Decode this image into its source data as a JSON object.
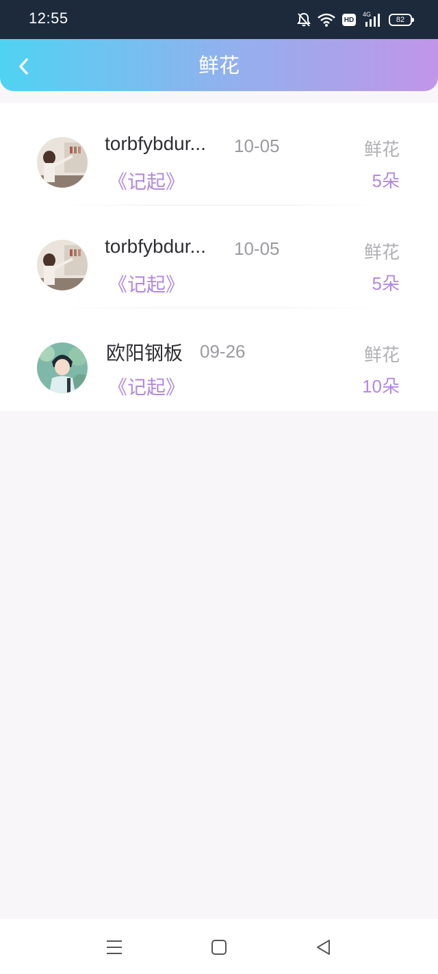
{
  "status_bar": {
    "time": "12:55",
    "network": "4G",
    "hd": "HD",
    "battery": "82"
  },
  "header": {
    "title": "鲜花",
    "back_icon": "chevron-left-icon"
  },
  "gifts": [
    {
      "name": "torbfybdur...",
      "date": "10-05",
      "work": "《记起》",
      "gift_type": "鲜花",
      "count": "5朵",
      "avatar": "girl-photo"
    },
    {
      "name": "torbfybdur...",
      "date": "10-05",
      "work": "《记起》",
      "gift_type": "鲜花",
      "count": "5朵",
      "avatar": "girl-photo"
    },
    {
      "name": "欧阳钢板",
      "date": "09-26",
      "work": "《记起》",
      "gift_type": "鲜花",
      "count": "10朵",
      "avatar": "anime-boy"
    }
  ],
  "nav_bar": {
    "menu_icon": "menu-icon",
    "home_icon": "square-home-icon",
    "back_icon": "triangle-back-icon"
  },
  "colors": {
    "accent_purple": "#b189e0",
    "header_gradient_start": "#4fd3f3",
    "header_gradient_end": "#c195ea",
    "status_bar_bg": "#1c2a3c"
  }
}
